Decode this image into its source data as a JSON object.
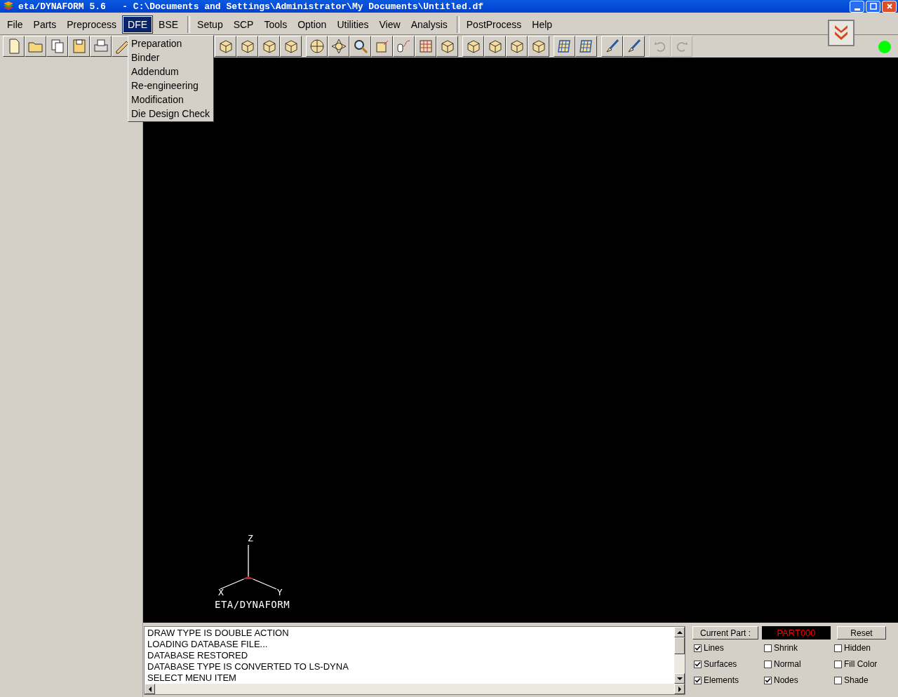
{
  "window": {
    "title": "eta/DYNAFORM 5.6   - C:\\Documents and Settings\\Administrator\\My Documents\\Untitled.df"
  },
  "menu_bar": [
    [
      {
        "label": "File",
        "selected": false
      },
      {
        "label": "Parts",
        "selected": false
      },
      {
        "label": "Preprocess",
        "selected": false
      },
      {
        "label": "DFE",
        "selected": true
      },
      {
        "label": "BSE",
        "selected": false
      }
    ],
    [
      {
        "label": "Setup",
        "selected": false
      },
      {
        "label": "SCP",
        "selected": false
      },
      {
        "label": "Tools",
        "selected": false
      },
      {
        "label": "Option",
        "selected": false
      },
      {
        "label": "Utilities",
        "selected": false
      },
      {
        "label": "View",
        "selected": false
      },
      {
        "label": "Analysis",
        "selected": false
      }
    ],
    [
      {
        "label": "PostProcess",
        "selected": false
      },
      {
        "label": "Help",
        "selected": false
      }
    ]
  ],
  "dropdown": {
    "items": [
      "Preparation",
      "Binder",
      "Addendum",
      "Re-engineering",
      "Modification",
      "Die Design Check"
    ]
  },
  "toolbar": [
    [
      {
        "kind": "new",
        "disabled": false
      },
      {
        "kind": "open",
        "disabled": false
      },
      {
        "kind": "copy",
        "disabled": false
      },
      {
        "kind": "save",
        "disabled": false
      },
      {
        "kind": "print",
        "disabled": false
      },
      {
        "kind": "pencil",
        "disabled": false
      }
    ],
    [
      {
        "kind": "cube",
        "disabled": false
      },
      {
        "kind": "cube",
        "disabled": false
      },
      {
        "kind": "cube",
        "disabled": false
      },
      {
        "kind": "cube",
        "disabled": false
      }
    ],
    [
      {
        "kind": "sphere",
        "disabled": false
      },
      {
        "kind": "pan",
        "disabled": false
      },
      {
        "kind": "zoom",
        "disabled": false
      },
      {
        "kind": "frame",
        "disabled": false
      },
      {
        "kind": "mouse",
        "disabled": false
      },
      {
        "kind": "grid",
        "disabled": false
      },
      {
        "kind": "cube",
        "disabled": false
      }
    ],
    [
      {
        "kind": "cube",
        "disabled": false
      },
      {
        "kind": "cube",
        "disabled": false
      },
      {
        "kind": "cube",
        "disabled": false
      },
      {
        "kind": "cube",
        "disabled": false
      }
    ],
    [
      {
        "kind": "mesh",
        "disabled": false
      },
      {
        "kind": "mesh",
        "disabled": false
      }
    ],
    [
      {
        "kind": "brush",
        "disabled": false
      },
      {
        "kind": "brush",
        "disabled": false
      }
    ],
    [
      {
        "kind": "undo",
        "disabled": true
      },
      {
        "kind": "redo",
        "disabled": true
      }
    ]
  ],
  "status_indicator": {
    "color": "#00ff00"
  },
  "viewport": {
    "axes": {
      "z": "Z",
      "x": "X",
      "y": "Y"
    },
    "logo": "ETA/DYNAFORM"
  },
  "messages": [
    "DRAW TYPE IS DOUBLE ACTION",
    "LOADING DATABASE FILE...",
    "DATABASE RESTORED",
    "DATABASE TYPE IS CONVERTED TO LS-DYNA",
    "SELECT MENU ITEM"
  ],
  "display_panel": {
    "current_part_label": "Current Part :",
    "current_part": "PART000",
    "reset": "Reset",
    "options": [
      {
        "label": "Lines",
        "checked": true
      },
      {
        "label": "Shrink",
        "checked": false
      },
      {
        "label": "Hidden",
        "checked": false
      },
      {
        "label": "Surfaces",
        "checked": true
      },
      {
        "label": "Normal",
        "checked": false
      },
      {
        "label": "Fill Color",
        "checked": false
      },
      {
        "label": "Elements",
        "checked": true
      },
      {
        "label": "Nodes",
        "checked": true
      },
      {
        "label": "Shade",
        "checked": false
      }
    ]
  }
}
